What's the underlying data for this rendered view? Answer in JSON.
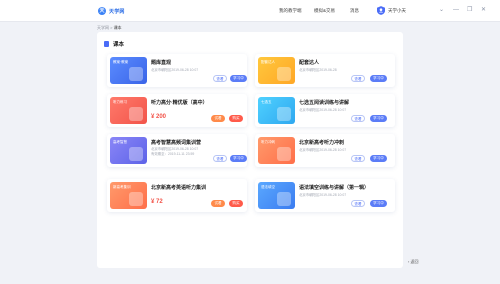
{
  "app": {
    "logo_mark": "天",
    "logo_text": "天学网"
  },
  "nav": [
    "我的教学端",
    "模拟&交易",
    "消息"
  ],
  "user": {
    "name": "天学小天"
  },
  "window_controls": [
    "⌄",
    "—",
    "❐",
    "✕"
  ],
  "breadcrumb": {
    "prefix": "天学网 > ",
    "current": "课本"
  },
  "panel": {
    "title": "课本"
  },
  "cards": [
    {
      "thumb_tag": "教案·教案",
      "thumb_color": "#3a64e8",
      "title": "题库直观",
      "meta": "北京市朝阳区2019-06-28 10:07",
      "btn1": "查看",
      "btn2": "学习中"
    },
    {
      "thumb_tag": "配套达人",
      "thumb_color": "#ffa726",
      "title": "配套达人",
      "meta": "北京市朝阳区2019-06-28",
      "btn1": "查看",
      "btn2": "学习中"
    },
    {
      "thumb_tag": "听力练习",
      "thumb_color": "#f2544a",
      "title": "听力高分·精优版（高中）",
      "price": "¥ 200",
      "btn1": "试看",
      "btn2": "购买"
    },
    {
      "thumb_tag": "七选五",
      "thumb_color": "#2fa8f0",
      "title": "七选五阅读训练与讲解",
      "meta": "北京市朝阳区2019-06-28 10:07",
      "btn1": "查看",
      "btn2": "学习中"
    },
    {
      "thumb_tag": "高考智慧",
      "thumb_color": "#5d63e8",
      "title": "高考智慧高频词集训营",
      "meta": "北京市朝阳区2019-06-28 10:07",
      "meta2": "有效期至：2019-11-11 23:59",
      "btn1": "查看",
      "btn2": "学习中"
    },
    {
      "thumb_tag": "听力冲刺",
      "thumb_color": "#ff6f4a",
      "title": "北京新高考听力冲刺",
      "meta": "北京市朝阳区2019-06-28 10:07",
      "btn1": "查看",
      "btn2": "学习中"
    },
    {
      "thumb_tag": "新高考集训",
      "thumb_color": "#ff6f4a",
      "title": "北京新高考英语听力集训",
      "price": "¥ 72",
      "btn1": "试看",
      "btn2": "购买"
    },
    {
      "thumb_tag": "语法填空",
      "thumb_color": "#3b7cf0",
      "title": "语法填空训练与讲解（第一辑）",
      "meta": "北京市朝阳区2019-06-28 10:07",
      "btn1": "查看",
      "btn2": "学习中"
    }
  ],
  "back": "‹ 返回"
}
